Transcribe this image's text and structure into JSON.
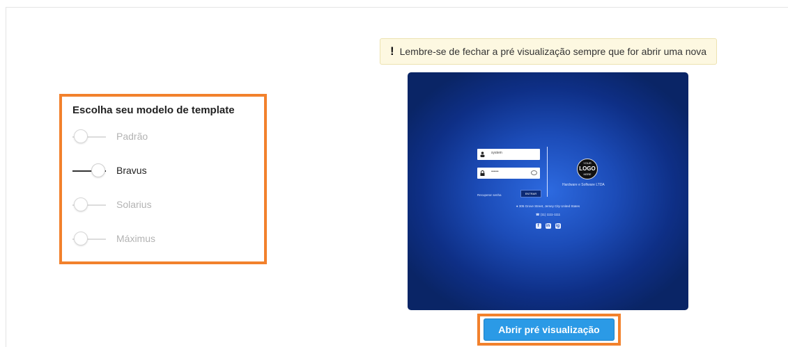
{
  "template_selector": {
    "title": "Escolha seu modelo de template",
    "options": [
      {
        "label": "Padrão",
        "selected": false
      },
      {
        "label": "Bravus",
        "selected": true
      },
      {
        "label": "Solarius",
        "selected": false
      },
      {
        "label": "Máximus",
        "selected": false
      }
    ]
  },
  "warning": {
    "icon": "!",
    "text": "Lembre-se de fechar a pré visualização sempre que for abrir uma nova"
  },
  "preview": {
    "user_value": "system",
    "password_value": "••••••",
    "recover_link": "Recuperar senha",
    "enter_button": "ENTRAR",
    "logo": {
      "line1": "YOUR",
      "line2": "LOGO",
      "line3": "HERE"
    },
    "company": "Hardware e Software LTDA",
    "address": "305 Grove Street, Jersey City United States",
    "phone": "(11) 1111-1111",
    "social": [
      "f",
      "in",
      "ig"
    ]
  },
  "open_preview_button": "Abrir pré visualização",
  "colors": {
    "highlight_border": "#f2812c",
    "button": "#2b9ae6",
    "warning_bg": "#fdf8e1"
  }
}
